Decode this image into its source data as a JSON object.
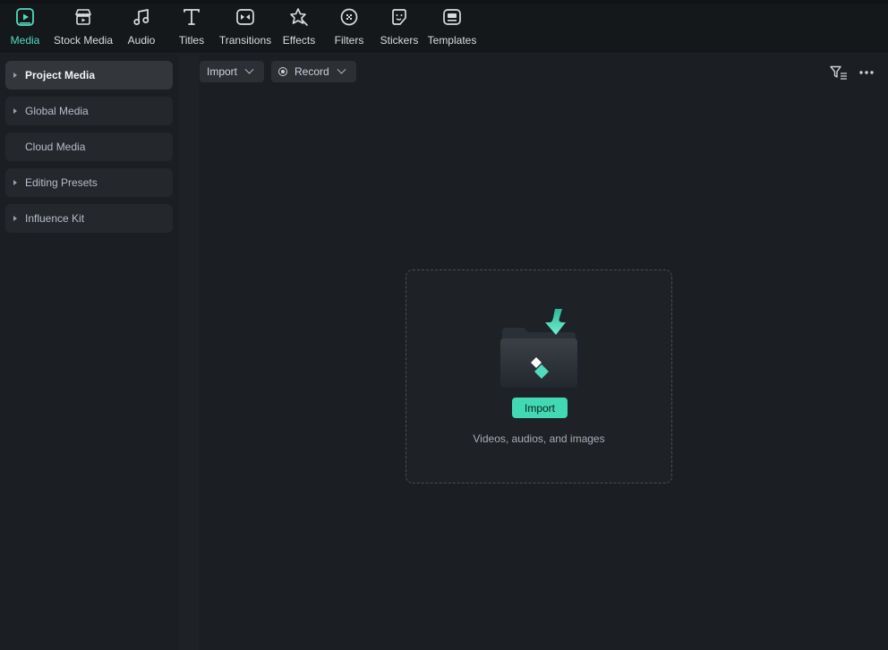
{
  "toolbar": {
    "items": [
      {
        "label": "Media",
        "icon": "media-icon",
        "active": true
      },
      {
        "label": "Stock Media",
        "icon": "stock-media-icon"
      },
      {
        "label": "Audio",
        "icon": "audio-icon"
      },
      {
        "label": "Titles",
        "icon": "titles-icon"
      },
      {
        "label": "Transitions",
        "icon": "transitions-icon"
      },
      {
        "label": "Effects",
        "icon": "effects-icon"
      },
      {
        "label": "Filters",
        "icon": "filters-icon"
      },
      {
        "label": "Stickers",
        "icon": "stickers-icon"
      },
      {
        "label": "Templates",
        "icon": "templates-icon"
      }
    ]
  },
  "sidebar": {
    "items": [
      {
        "label": "Project Media",
        "expandable": true,
        "active": true
      },
      {
        "label": "Global Media",
        "expandable": true
      },
      {
        "label": "Cloud Media",
        "expandable": false
      },
      {
        "label": "Editing Presets",
        "expandable": true
      },
      {
        "label": "Influence Kit",
        "expandable": true
      }
    ]
  },
  "main": {
    "import_dropdown": "Import",
    "record_dropdown": "Record",
    "dropzone": {
      "button": "Import",
      "hint": "Videos, audios, and images"
    }
  },
  "colors": {
    "accent": "#41d8b4",
    "active_tab": "#4fdcbe",
    "background": "#1b1e22"
  }
}
